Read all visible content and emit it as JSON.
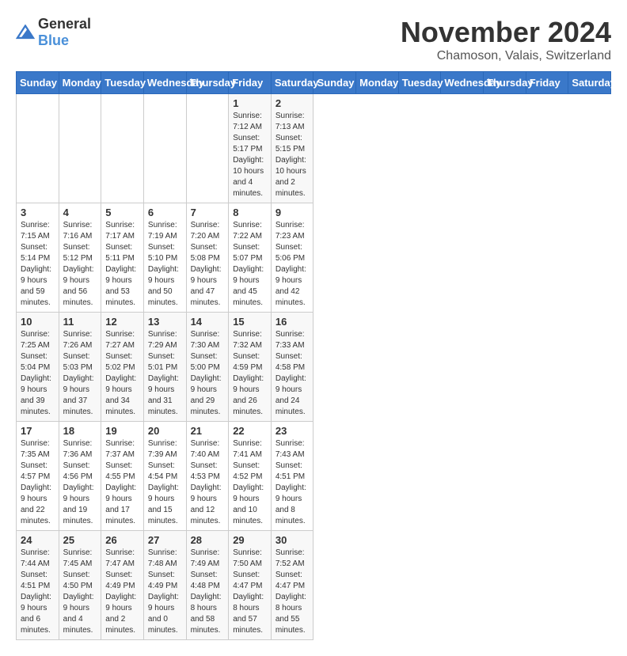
{
  "header": {
    "logo_general": "General",
    "logo_blue": "Blue",
    "month_year": "November 2024",
    "location": "Chamoson, Valais, Switzerland"
  },
  "days_of_week": [
    "Sunday",
    "Monday",
    "Tuesday",
    "Wednesday",
    "Thursday",
    "Friday",
    "Saturday"
  ],
  "weeks": [
    [
      {
        "day": "",
        "info": ""
      },
      {
        "day": "",
        "info": ""
      },
      {
        "day": "",
        "info": ""
      },
      {
        "day": "",
        "info": ""
      },
      {
        "day": "",
        "info": ""
      },
      {
        "day": "1",
        "info": "Sunrise: 7:12 AM\nSunset: 5:17 PM\nDaylight: 10 hours\nand 4 minutes."
      },
      {
        "day": "2",
        "info": "Sunrise: 7:13 AM\nSunset: 5:15 PM\nDaylight: 10 hours\nand 2 minutes."
      }
    ],
    [
      {
        "day": "3",
        "info": "Sunrise: 7:15 AM\nSunset: 5:14 PM\nDaylight: 9 hours\nand 59 minutes."
      },
      {
        "day": "4",
        "info": "Sunrise: 7:16 AM\nSunset: 5:12 PM\nDaylight: 9 hours\nand 56 minutes."
      },
      {
        "day": "5",
        "info": "Sunrise: 7:17 AM\nSunset: 5:11 PM\nDaylight: 9 hours\nand 53 minutes."
      },
      {
        "day": "6",
        "info": "Sunrise: 7:19 AM\nSunset: 5:10 PM\nDaylight: 9 hours\nand 50 minutes."
      },
      {
        "day": "7",
        "info": "Sunrise: 7:20 AM\nSunset: 5:08 PM\nDaylight: 9 hours\nand 47 minutes."
      },
      {
        "day": "8",
        "info": "Sunrise: 7:22 AM\nSunset: 5:07 PM\nDaylight: 9 hours\nand 45 minutes."
      },
      {
        "day": "9",
        "info": "Sunrise: 7:23 AM\nSunset: 5:06 PM\nDaylight: 9 hours\nand 42 minutes."
      }
    ],
    [
      {
        "day": "10",
        "info": "Sunrise: 7:25 AM\nSunset: 5:04 PM\nDaylight: 9 hours\nand 39 minutes."
      },
      {
        "day": "11",
        "info": "Sunrise: 7:26 AM\nSunset: 5:03 PM\nDaylight: 9 hours\nand 37 minutes."
      },
      {
        "day": "12",
        "info": "Sunrise: 7:27 AM\nSunset: 5:02 PM\nDaylight: 9 hours\nand 34 minutes."
      },
      {
        "day": "13",
        "info": "Sunrise: 7:29 AM\nSunset: 5:01 PM\nDaylight: 9 hours\nand 31 minutes."
      },
      {
        "day": "14",
        "info": "Sunrise: 7:30 AM\nSunset: 5:00 PM\nDaylight: 9 hours\nand 29 minutes."
      },
      {
        "day": "15",
        "info": "Sunrise: 7:32 AM\nSunset: 4:59 PM\nDaylight: 9 hours\nand 26 minutes."
      },
      {
        "day": "16",
        "info": "Sunrise: 7:33 AM\nSunset: 4:58 PM\nDaylight: 9 hours\nand 24 minutes."
      }
    ],
    [
      {
        "day": "17",
        "info": "Sunrise: 7:35 AM\nSunset: 4:57 PM\nDaylight: 9 hours\nand 22 minutes."
      },
      {
        "day": "18",
        "info": "Sunrise: 7:36 AM\nSunset: 4:56 PM\nDaylight: 9 hours\nand 19 minutes."
      },
      {
        "day": "19",
        "info": "Sunrise: 7:37 AM\nSunset: 4:55 PM\nDaylight: 9 hours\nand 17 minutes."
      },
      {
        "day": "20",
        "info": "Sunrise: 7:39 AM\nSunset: 4:54 PM\nDaylight: 9 hours\nand 15 minutes."
      },
      {
        "day": "21",
        "info": "Sunrise: 7:40 AM\nSunset: 4:53 PM\nDaylight: 9 hours\nand 12 minutes."
      },
      {
        "day": "22",
        "info": "Sunrise: 7:41 AM\nSunset: 4:52 PM\nDaylight: 9 hours\nand 10 minutes."
      },
      {
        "day": "23",
        "info": "Sunrise: 7:43 AM\nSunset: 4:51 PM\nDaylight: 9 hours\nand 8 minutes."
      }
    ],
    [
      {
        "day": "24",
        "info": "Sunrise: 7:44 AM\nSunset: 4:51 PM\nDaylight: 9 hours\nand 6 minutes."
      },
      {
        "day": "25",
        "info": "Sunrise: 7:45 AM\nSunset: 4:50 PM\nDaylight: 9 hours\nand 4 minutes."
      },
      {
        "day": "26",
        "info": "Sunrise: 7:47 AM\nSunset: 4:49 PM\nDaylight: 9 hours\nand 2 minutes."
      },
      {
        "day": "27",
        "info": "Sunrise: 7:48 AM\nSunset: 4:49 PM\nDaylight: 9 hours\nand 0 minutes."
      },
      {
        "day": "28",
        "info": "Sunrise: 7:49 AM\nSunset: 4:48 PM\nDaylight: 8 hours\nand 58 minutes."
      },
      {
        "day": "29",
        "info": "Sunrise: 7:50 AM\nSunset: 4:47 PM\nDaylight: 8 hours\nand 57 minutes."
      },
      {
        "day": "30",
        "info": "Sunrise: 7:52 AM\nSunset: 4:47 PM\nDaylight: 8 hours\nand 55 minutes."
      }
    ]
  ]
}
